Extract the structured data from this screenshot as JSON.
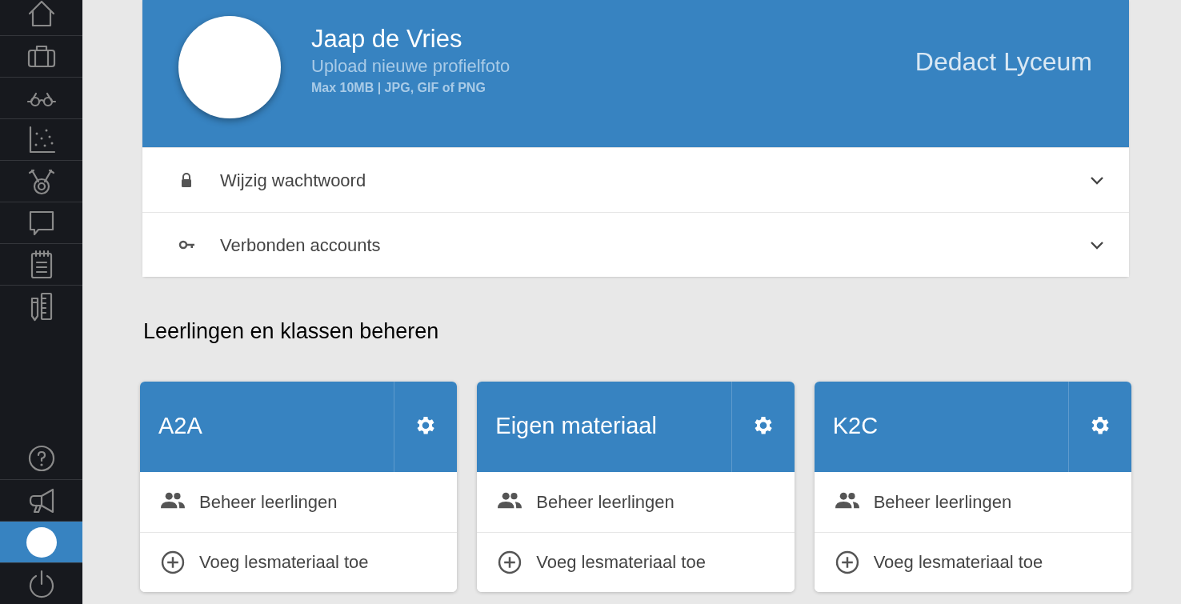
{
  "sidebar": {
    "top_items": [
      {
        "kind": "home",
        "selected": false
      },
      {
        "kind": "briefcase",
        "selected": false
      },
      {
        "kind": "glasses",
        "selected": false
      },
      {
        "kind": "scatter",
        "selected": false
      },
      {
        "kind": "medal",
        "selected": false
      },
      {
        "kind": "speech",
        "selected": false
      },
      {
        "kind": "notepad",
        "selected": false
      },
      {
        "kind": "tools",
        "selected": false
      }
    ],
    "bottom_items": [
      {
        "kind": "help",
        "selected": false
      },
      {
        "kind": "megaphone",
        "selected": false
      },
      {
        "kind": "avatar",
        "selected": true
      },
      {
        "kind": "power",
        "selected": false
      }
    ]
  },
  "profile": {
    "name": "Jaap de Vries",
    "upload_link": "Upload nieuwe profielfoto",
    "upload_hint": "Max 10MB | JPG, GIF of PNG",
    "school": "Dedact Lyceum"
  },
  "settings": [
    {
      "kind": "lock",
      "label": "Wijzig wachtwoord",
      "expanded": false
    },
    {
      "kind": "key",
      "label": "Verbonden accounts",
      "expanded": false
    }
  ],
  "section_title": "Leerlingen en klassen beheren",
  "classes": [
    {
      "name": "A2A",
      "actions": [
        {
          "kind": "people",
          "label": "Beheer leerlingen"
        },
        {
          "kind": "add",
          "label": "Voeg lesmateriaal toe"
        }
      ]
    },
    {
      "name": "Eigen materiaal",
      "actions": [
        {
          "kind": "people",
          "label": "Beheer leerlingen"
        },
        {
          "kind": "add",
          "label": "Voeg lesmateriaal toe"
        }
      ]
    },
    {
      "name": "K2C",
      "actions": [
        {
          "kind": "people",
          "label": "Beheer leerlingen"
        },
        {
          "kind": "add",
          "label": "Voeg lesmateriaal toe"
        }
      ]
    }
  ]
}
